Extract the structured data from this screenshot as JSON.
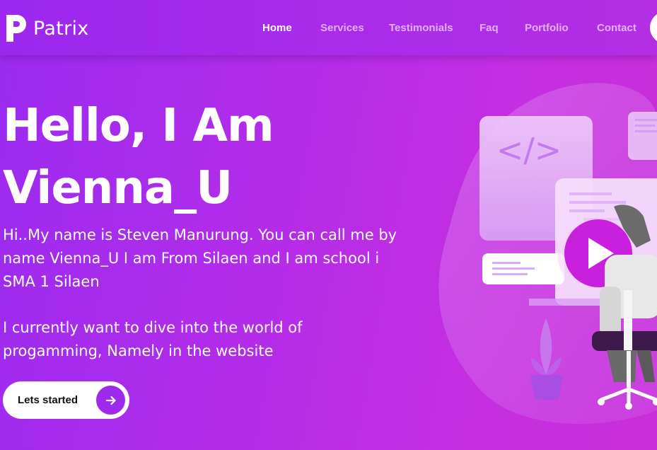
{
  "brand": {
    "name": "Patrix"
  },
  "nav": {
    "items": [
      {
        "label": "Home",
        "active": true
      },
      {
        "label": "Services",
        "active": false
      },
      {
        "label": "Testimonials",
        "active": false
      },
      {
        "label": "Faq",
        "active": false
      },
      {
        "label": "Portfolio",
        "active": false
      },
      {
        "label": "Contact",
        "active": false
      }
    ]
  },
  "hero": {
    "headline_line1": "Hello, I Am",
    "headline_line2": "Vienna_U",
    "intro": "Hi..My name is Steven Manurung. You can call me by name Vienna_U I am From Silaen and I am school i SMA 1 Silaen",
    "goal": "I currently want to dive into the world of progamming, Namely in the website",
    "cta_label": "Lets started"
  },
  "illustration": {
    "code_symbol": "</>"
  },
  "colors": {
    "accent": "#9e2bec",
    "background_start": "#9b2bf0",
    "background_end": "#c82fd8",
    "play_button": "#c820dc"
  }
}
